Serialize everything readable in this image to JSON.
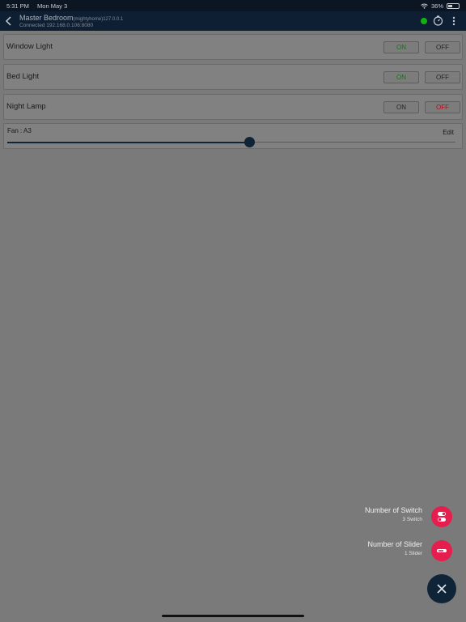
{
  "status": {
    "time": "5:31 PM",
    "date": "Mon May 3",
    "battery": "36%"
  },
  "header": {
    "title": "Master Bedroom",
    "subtitle": "(mightyhome)127.0.0.1",
    "connection": "Connected 192.168.0.106:8080"
  },
  "switches": [
    {
      "label": "Window Light",
      "on_label": "ON",
      "off_label": "OFF",
      "state": "on"
    },
    {
      "label": "Bed Light",
      "on_label": "ON",
      "off_label": "OFF",
      "state": "on"
    },
    {
      "label": "Night Lamp",
      "on_label": "ON",
      "off_label": "OFF",
      "state": "off"
    }
  ],
  "slider": {
    "label": "Fan : A3",
    "edit_label": "Edit",
    "value_fraction": 0.54
  },
  "fab": {
    "switch_title": "Number of Switch",
    "switch_sub": "3 Switch",
    "slider_title": "Number of Slider",
    "slider_sub": "1 Slider"
  },
  "colors": {
    "accent": "#e61e4d",
    "on_green": "#0b7d0b",
    "off_red": "#b0101a",
    "navy": "#0f2436"
  }
}
